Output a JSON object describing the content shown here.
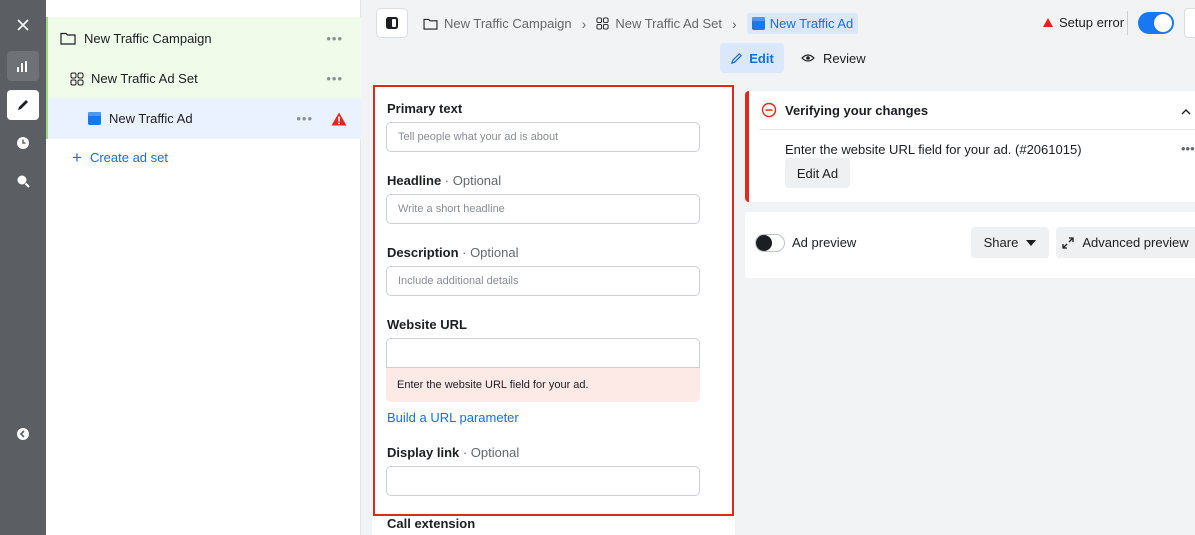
{
  "tree": {
    "campaign": {
      "label": "New Traffic Campaign",
      "more": "•••"
    },
    "adset": {
      "label": "New Traffic Ad Set",
      "more": "•••"
    },
    "ad": {
      "label": "New Traffic Ad",
      "more": "•••"
    },
    "create_label": "Create ad set"
  },
  "breadcrumb": {
    "campaign": "New Traffic Campaign",
    "adset": "New Traffic Ad Set",
    "ad": "New Traffic Ad"
  },
  "header": {
    "setup_error": "Setup error",
    "tab_edit": "Edit",
    "tab_review": "Review"
  },
  "form": {
    "primary_text": {
      "label": "Primary text",
      "placeholder": "Tell people what your ad is about"
    },
    "headline": {
      "label": "Headline",
      "optional": " · Optional",
      "placeholder": "Write a short headline"
    },
    "description": {
      "label": "Description",
      "optional": " · Optional",
      "placeholder": "Include additional details"
    },
    "website_url": {
      "label": "Website URL",
      "value": "",
      "error": "Enter the website URL field for your ad."
    },
    "url_param_link": "Build a URL parameter",
    "display_link": {
      "label": "Display link",
      "optional": " · Optional",
      "value": ""
    },
    "call_extension": "Call extension"
  },
  "verify": {
    "title": "Verifying your changes",
    "message": "Enter the website URL field for your ad. (#2061015)",
    "more": "•••",
    "edit_ad": "Edit Ad"
  },
  "preview": {
    "label": "Ad preview",
    "share": "Share",
    "advanced": "Advanced preview"
  },
  "colors": {
    "accent": "#1877f2",
    "error": "#e0281f",
    "rail": "#5b5f63"
  }
}
